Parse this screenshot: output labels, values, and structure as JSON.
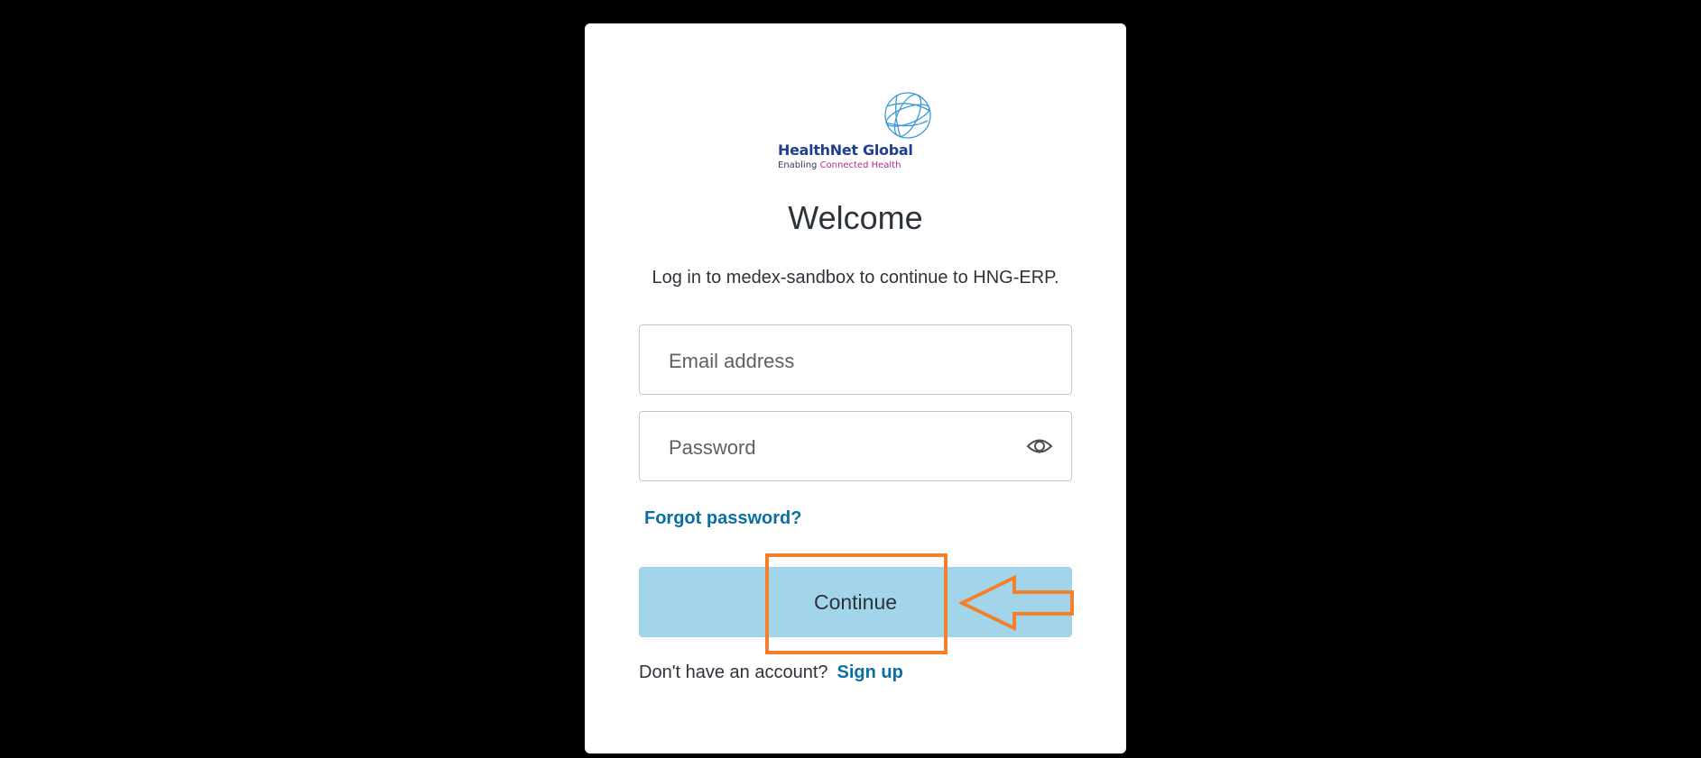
{
  "brand": {
    "name": "HealthNet Global",
    "tagline_part1": "Enabling",
    "tagline_part2": "Connected Health"
  },
  "login": {
    "heading": "Welcome",
    "subtitle": "Log in to medex-sandbox to continue to HNG-ERP.",
    "email_placeholder": "Email address",
    "password_placeholder": "Password",
    "forgot_password": "Forgot password?",
    "continue_label": "Continue",
    "no_account_text": "Don't have an account?",
    "signup_label": "Sign up"
  },
  "colors": {
    "page_background": "#000000",
    "card_background": "#ffffff",
    "button": "#a2d5ea",
    "link": "#0a6fa1",
    "annotation": "#f5802c"
  },
  "icons": {
    "password_toggle": "eye-icon",
    "logo_mark": "globe-icon"
  },
  "annotation": {
    "highlight": "continue-button",
    "pointer": "left-arrow"
  }
}
